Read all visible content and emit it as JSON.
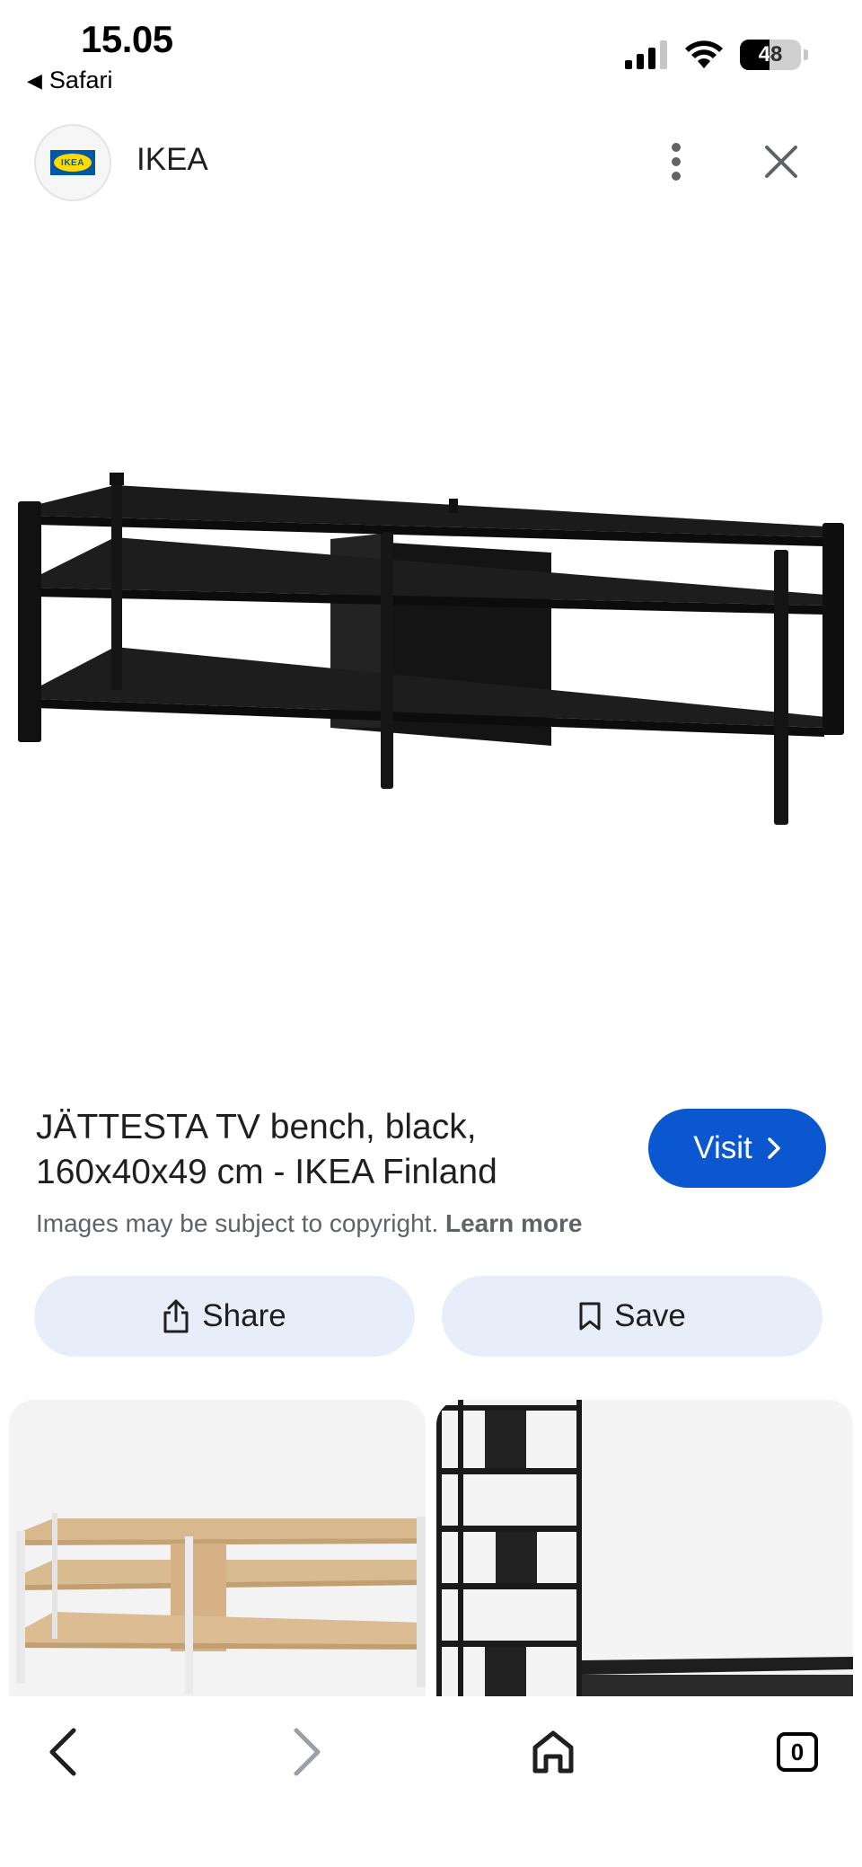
{
  "status_bar": {
    "time": "15.05",
    "back_app": "Safari",
    "battery_level": "48",
    "battery_fraction": 0.48
  },
  "header": {
    "site_name": "IKEA",
    "logo_text": "IKEA"
  },
  "result": {
    "title": "JÄTTESTA TV bench, black, 160x40x49 cm - IKEA Finland",
    "visit_label": "Visit",
    "copyright_text": "Images may be subject to copyright.",
    "learn_more": "Learn more"
  },
  "actions": {
    "share_label": "Share",
    "save_label": "Save"
  },
  "bottom_nav": {
    "tabs_count": "0"
  },
  "colors": {
    "accent": "#0b57d0",
    "action_bg": "#e8eef9",
    "muted_text": "#5f6368"
  },
  "icons": [
    "back-arrow-icon",
    "signal-icon",
    "wifi-icon",
    "battery-icon",
    "more-vert-icon",
    "close-icon",
    "chevron-right-icon",
    "share-icon",
    "bookmark-icon",
    "back-nav-icon",
    "forward-nav-icon",
    "home-icon",
    "tabs-icon"
  ]
}
